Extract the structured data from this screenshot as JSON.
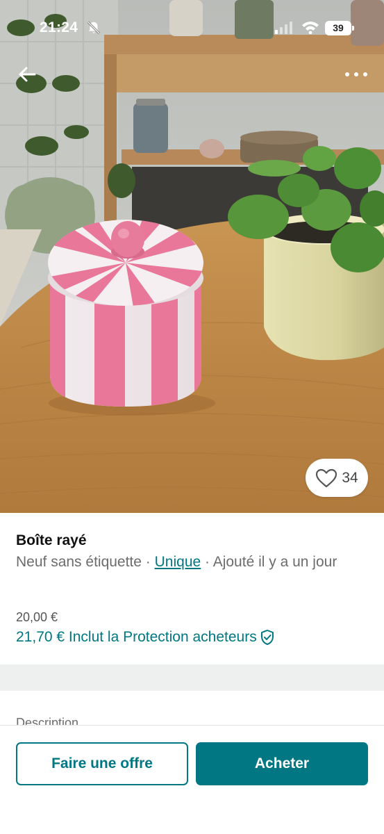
{
  "status_bar": {
    "time": "21:24",
    "battery": "39"
  },
  "nav": {
    "back_icon": "arrow-left-icon",
    "more_icon": "more-horizontal-icon"
  },
  "photo": {
    "favorites_count": "34",
    "favorite_icon": "heart-icon"
  },
  "item": {
    "title": "Boîte rayé",
    "condition": "Neuf sans étiquette",
    "separator_1": " · ",
    "size_link": "Unique",
    "separator_2": " · ",
    "added": "Ajouté il y a un jour",
    "price": "20,00 €",
    "price_total": "21,70 € Inclut la Protection acheteurs",
    "shield_icon": "shield-check-icon"
  },
  "description": {
    "label": "Description"
  },
  "actions": {
    "offer_label": "Faire une offre",
    "buy_label": "Acheter"
  },
  "colors": {
    "accent": "#007782",
    "box_pink": "#e87796"
  }
}
